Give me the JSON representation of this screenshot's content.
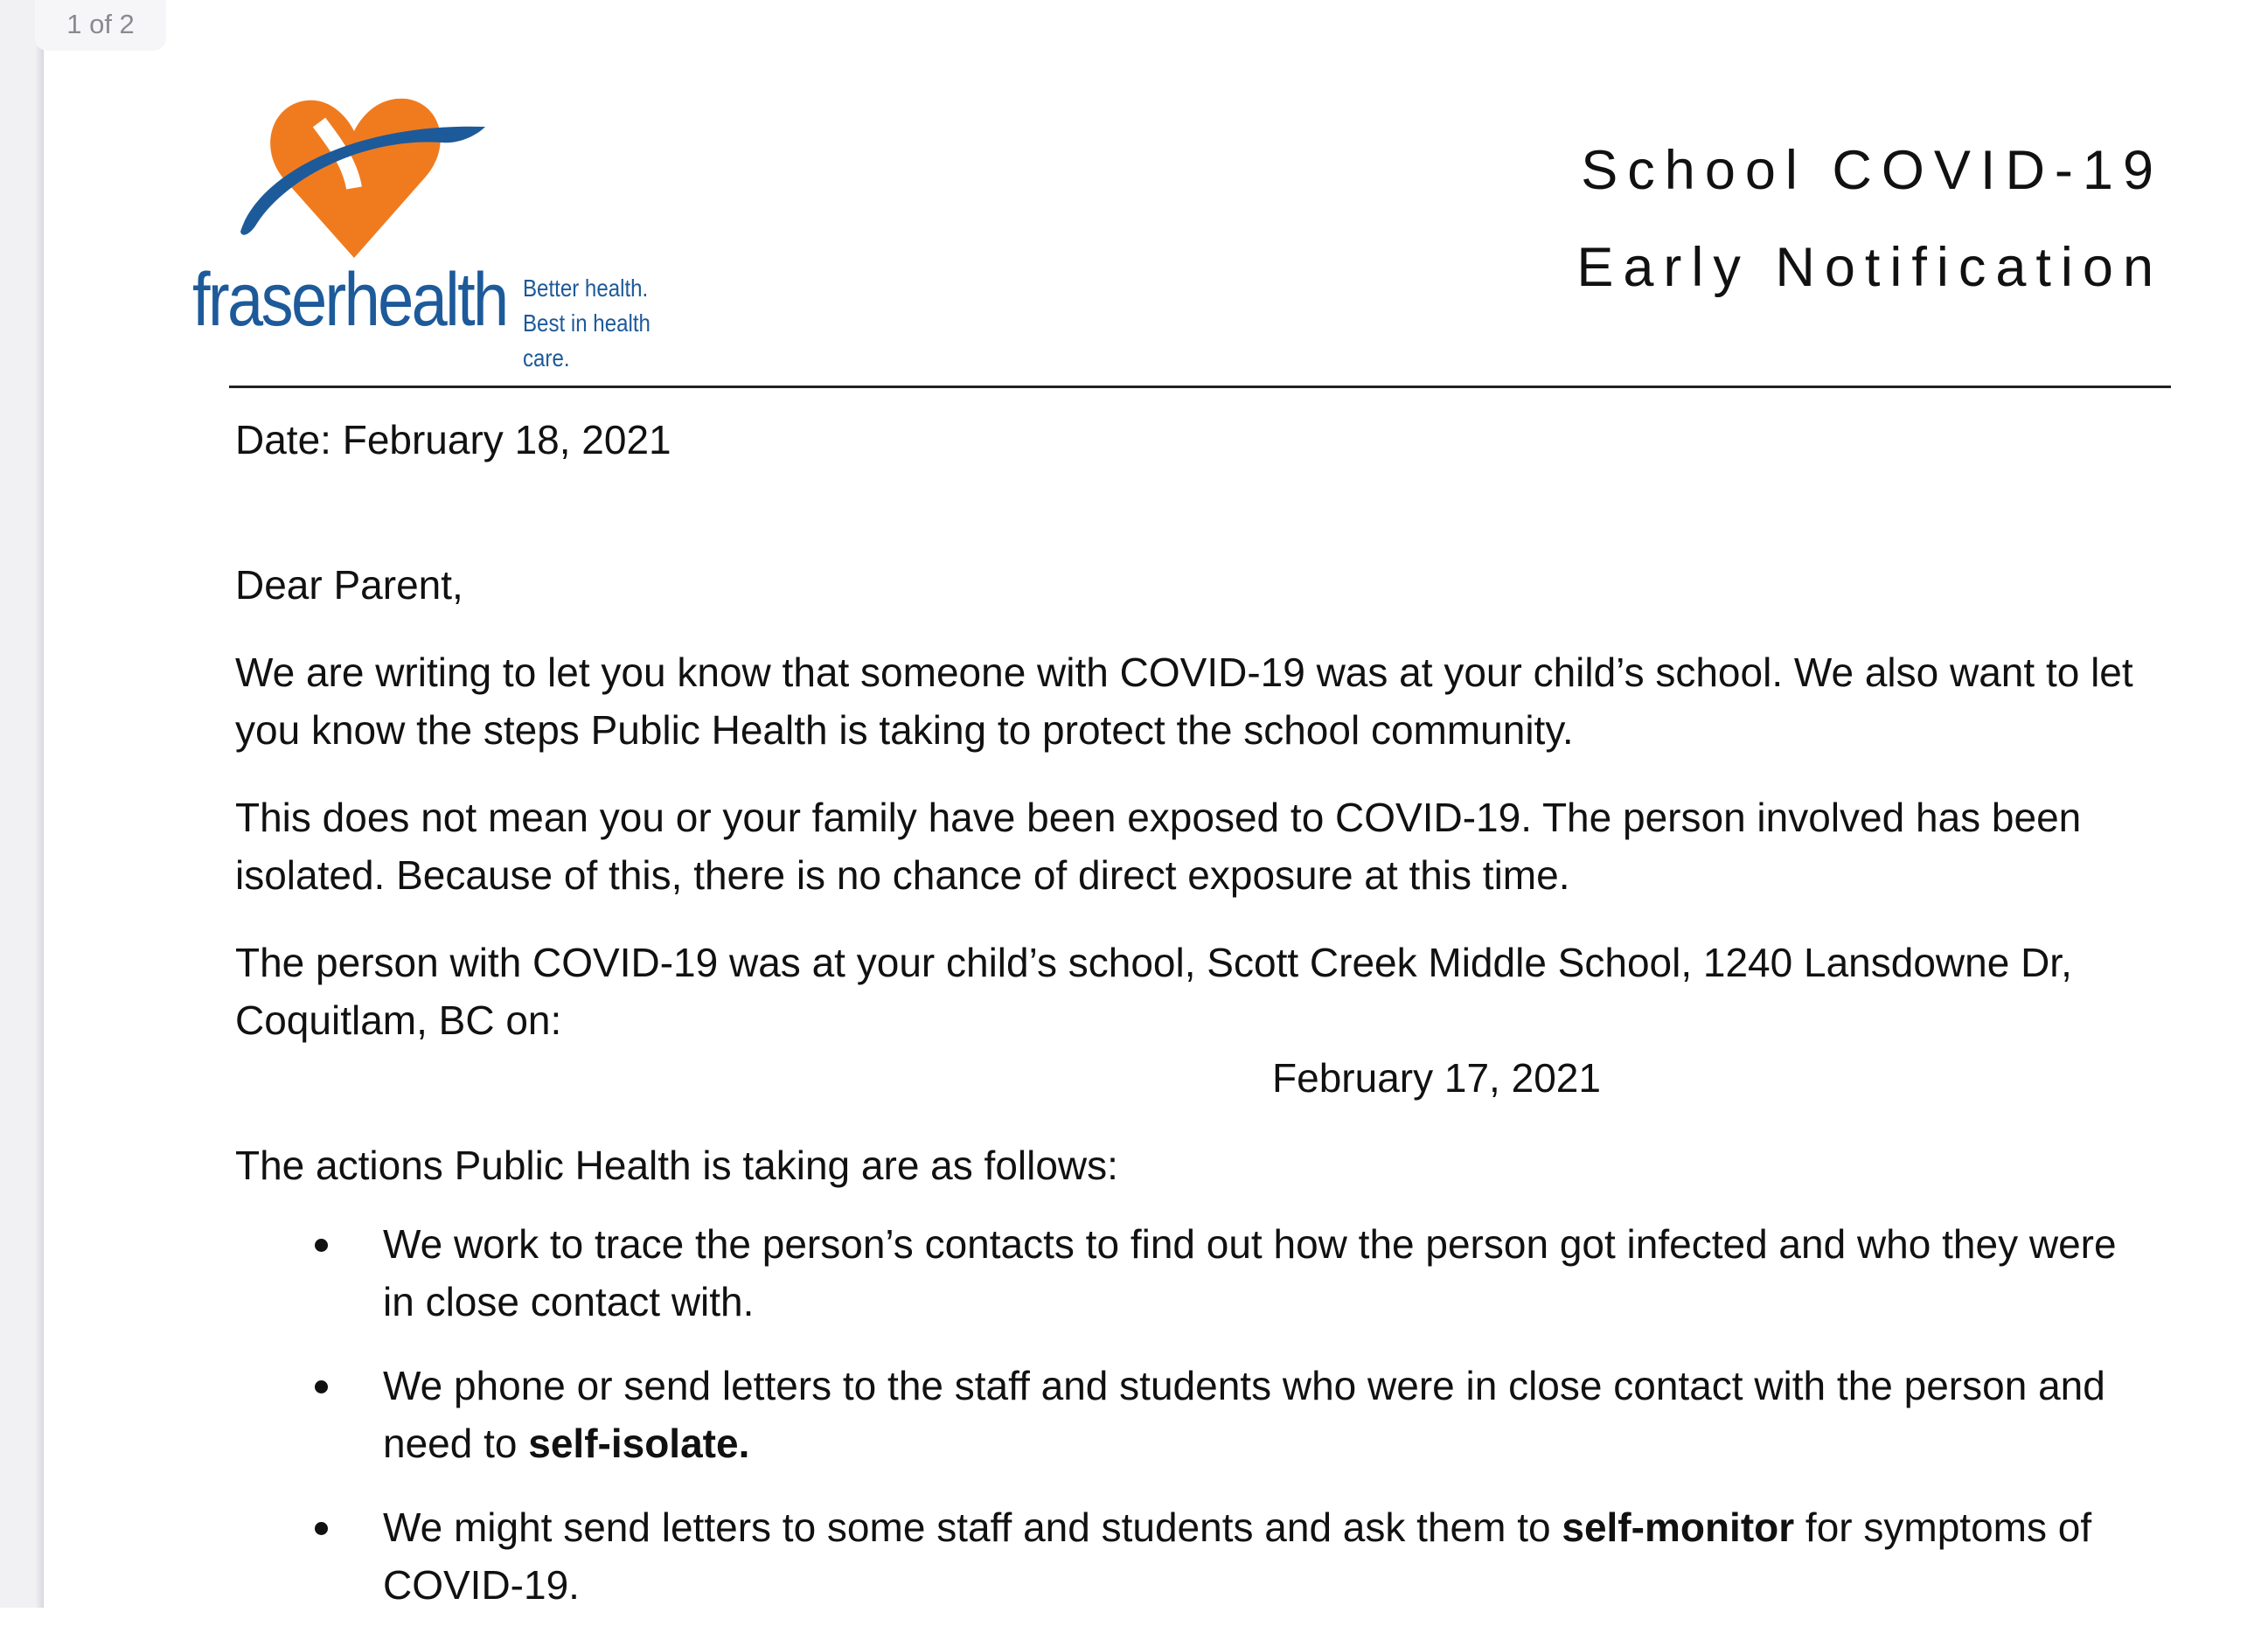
{
  "viewer": {
    "page_indicator": "1 of 2"
  },
  "logo": {
    "wordmark": "fraserhealth",
    "tagline_1": "Better health.",
    "tagline_2": "Best in health care.",
    "colors": {
      "heart": "#f07b1f",
      "swoosh": "#1d5a9a",
      "text": "#1d5a9a"
    }
  },
  "header": {
    "title_line_1": "School COVID-19",
    "title_line_2": "Early Notification"
  },
  "letter": {
    "date": "Date: February 18, 2021",
    "salutation": "Dear Parent,",
    "para1": "We are writing to let you know that someone with COVID-19 was at your child’s school. We also want to let you know the steps Public Health is taking to protect the school community.",
    "para2": "This does not mean you or your family have been exposed to COVID-19. The person involved has been isolated. Because of this, there is no chance of direct exposure at this time.",
    "para3": "The person with COVID-19 was at your child’s school, Scott Creek Middle School, 1240 Lansdowne Dr, Coquitlam, BC on:",
    "exposure_date": "February 17, 2021",
    "actions_intro": "The actions Public Health is taking are as follows:",
    "bullets": [
      {
        "text": "We work to trace the person’s contacts to find out how the person got infected and who they were in close contact with."
      },
      {
        "text_before": "We phone or send letters to the staff and students who were in close contact with the person and need to ",
        "bold": "self-isolate."
      },
      {
        "text_before": "We might send letters to some staff and students and ask them to ",
        "bold": "self-monitor",
        "text_after": " for symptoms of COVID-19."
      }
    ]
  }
}
